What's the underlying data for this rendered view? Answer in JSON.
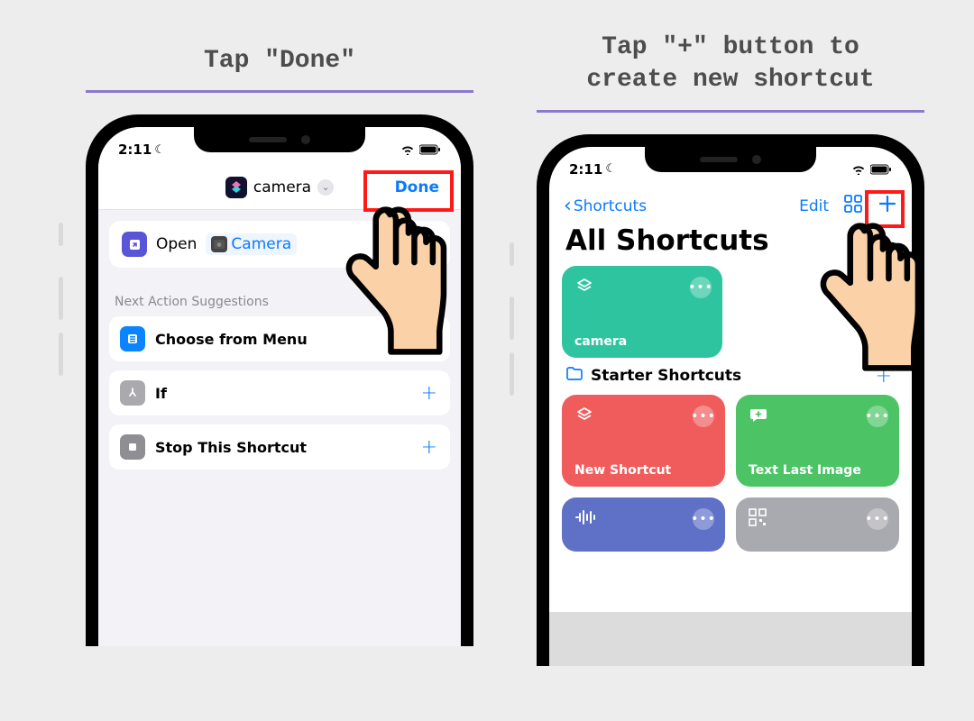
{
  "captions": {
    "left": "Tap \"Done\"",
    "right": "Tap \"+\" button to\ncreate new shortcut"
  },
  "status_time": "2:11",
  "screen1": {
    "title": "camera",
    "done": "Done",
    "action": {
      "verb": "Open",
      "app": "Camera"
    },
    "suggestions_label": "Next Action Suggestions",
    "suggestions": [
      {
        "label": "Choose from Menu",
        "color": "blue"
      },
      {
        "label": "If",
        "color": "gray"
      },
      {
        "label": "Stop This Shortcut",
        "color": "dgray"
      }
    ]
  },
  "screen2": {
    "back": "Shortcuts",
    "edit": "Edit",
    "title": "All Shortcuts",
    "tile_camera": "camera",
    "folder": "Starter Shortcuts",
    "tiles": [
      {
        "label": "New Shortcut",
        "color": "red"
      },
      {
        "label": "Text Last Image",
        "color": "grn2"
      }
    ]
  }
}
